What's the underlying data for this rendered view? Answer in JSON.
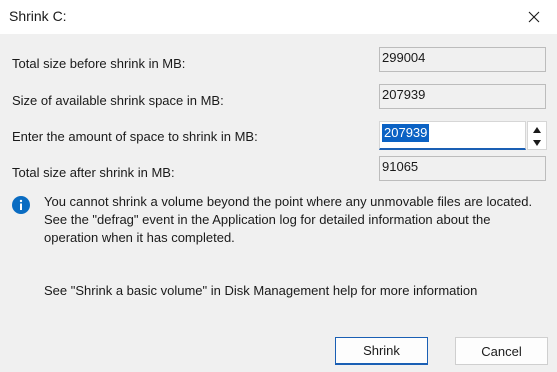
{
  "window": {
    "title": "Shrink C:"
  },
  "rows": {
    "total_before": {
      "label": "Total size before shrink in MB:",
      "value": "299004"
    },
    "available": {
      "label": "Size of available shrink space in MB:",
      "value": "207939"
    },
    "amount": {
      "label": "Enter the amount of space to shrink in MB:",
      "value": "207939"
    },
    "total_after": {
      "label": "Total size after shrink in MB:",
      "value": "91065"
    }
  },
  "info": {
    "icon": "info-icon",
    "text": "You cannot shrink a volume beyond the point where any unmovable files are located. See the \"defrag\" event in the Application log for detailed information about the operation when it has completed."
  },
  "help": "See \"Shrink a basic volume\" in Disk Management help for more information",
  "buttons": {
    "shrink": "Shrink",
    "cancel": "Cancel"
  },
  "colors": {
    "accent": "#0b62c4",
    "focus_border": "#1a5fb4",
    "info_icon": "#0a6cc2"
  }
}
